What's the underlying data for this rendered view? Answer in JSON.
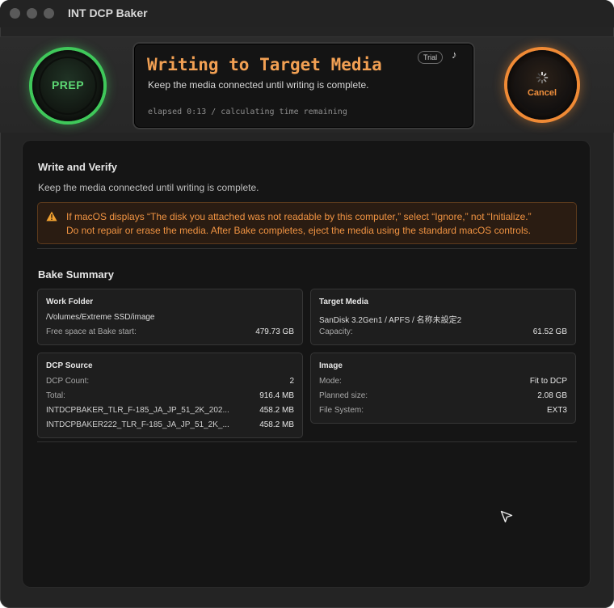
{
  "window": {
    "title": "INT DCP Baker"
  },
  "prep_button": {
    "label": "PREP"
  },
  "status": {
    "title": "Writing to Target Media",
    "subtitle": "Keep the media connected until writing is complete.",
    "elapsed": "elapsed 0:13 / calculating time remaining",
    "badge": "Trial",
    "music_icon": "music-note-icon"
  },
  "cancel_button": {
    "label": "Cancel"
  },
  "content": {
    "heading": "Write and Verify",
    "description": "Keep the media connected until writing is complete.",
    "warning": {
      "icon": "warning-triangle-icon",
      "line1": "If macOS displays “The disk you attached was not readable by this computer,” select “Ignore,” not “Initialize.”",
      "line2": "Do not repair or erase the media. After Bake completes, eject the media using the standard macOS controls."
    },
    "summary_heading": "Bake Summary",
    "work_folder": {
      "title": "Work Folder",
      "path": "/Volumes/Extreme SSD/image",
      "free_label": "Free space at Bake start:",
      "free_value": "479.73 GB"
    },
    "target_media": {
      "title": "Target Media",
      "device": "SanDisk 3.2Gen1 / APFS / 名称未設定2",
      "capacity_label": "Capacity:",
      "capacity_value": "61.52 GB"
    },
    "dcp_source": {
      "title": "DCP Source",
      "rows": [
        {
          "label": "DCP Count:",
          "value": "2"
        },
        {
          "label": "Total:",
          "value": "916.4 MB"
        },
        {
          "label": "INTDCPBAKER_TLR_F-185_JA_JP_51_2K_202...",
          "value": "458.2 MB"
        },
        {
          "label": "INTDCPBAKER222_TLR_F-185_JA_JP_51_2K_...",
          "value": "458.2 MB"
        }
      ]
    },
    "image": {
      "title": "Image",
      "rows": [
        {
          "label": "Mode:",
          "value": "Fit to DCP"
        },
        {
          "label": "Planned size:",
          "value": "2.08 GB"
        },
        {
          "label": "File System:",
          "value": "EXT3"
        }
      ]
    }
  },
  "colors": {
    "accent_green": "#3fc85a",
    "accent_orange": "#f08a35",
    "warning_text": "#f09342"
  }
}
